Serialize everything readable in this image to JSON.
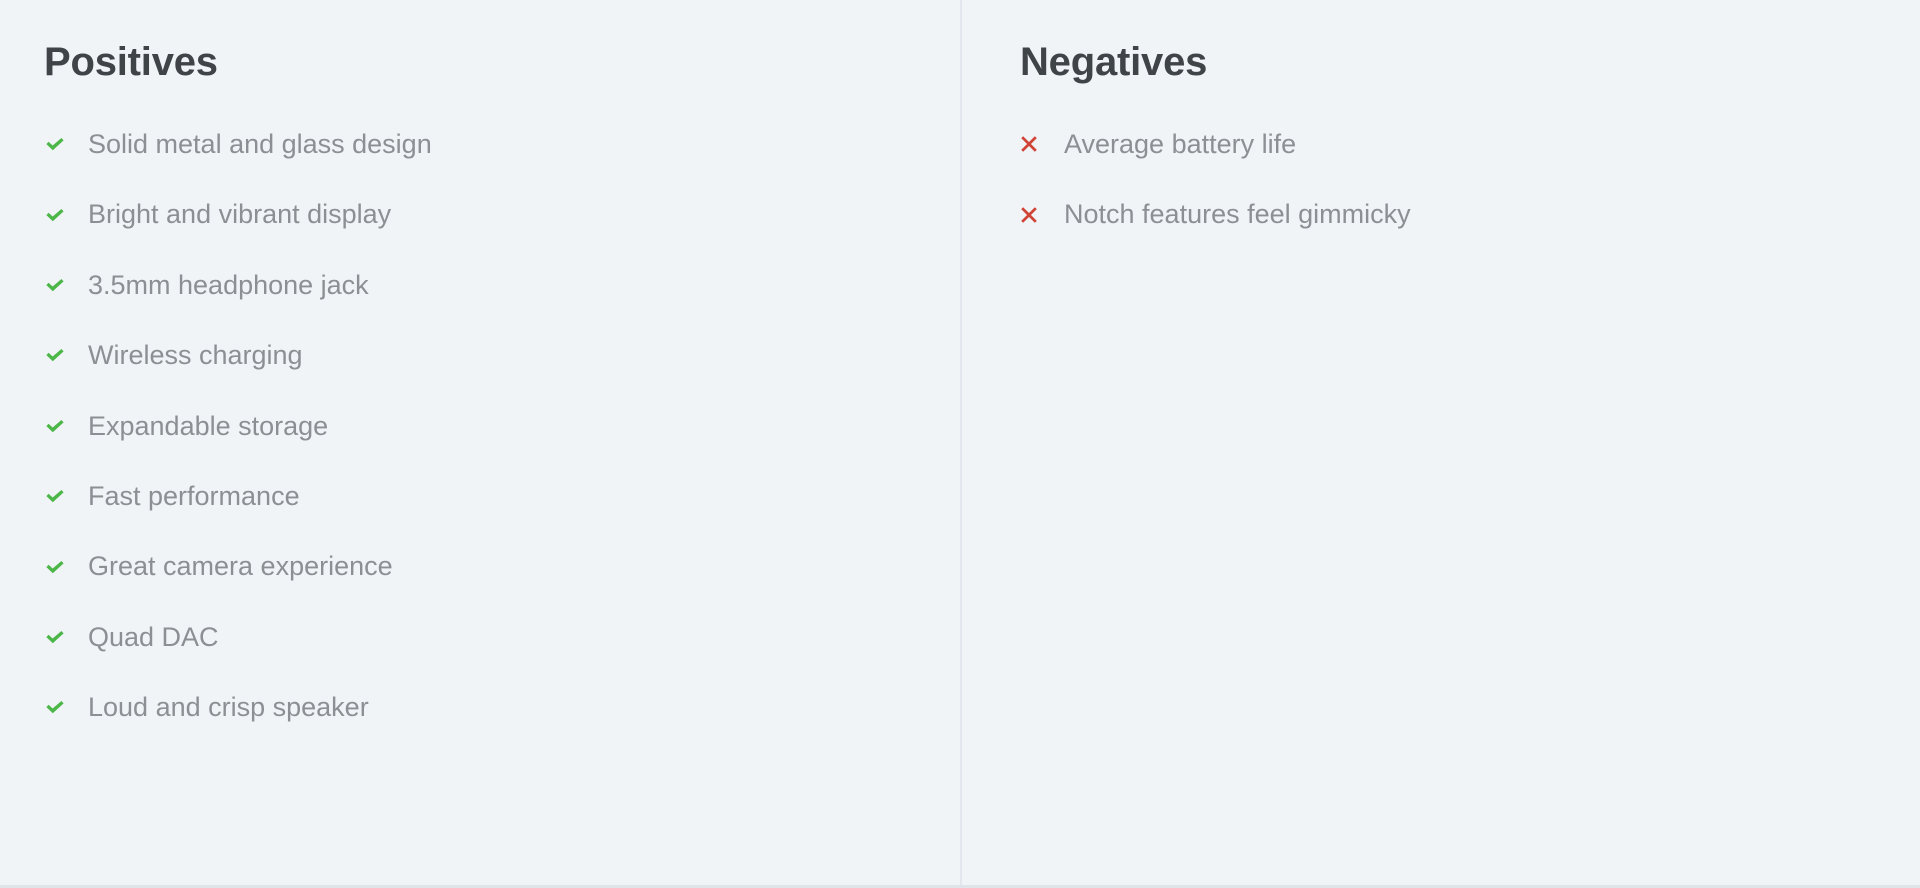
{
  "colors": {
    "background": "#f1f4f7",
    "divider": "#e3e7ed",
    "bottom_border": "#dfe4ea",
    "heading_text": "#3f4449",
    "item_text": "#8c8f93",
    "check_green": "#4cb748",
    "cross_red": "#cf4436"
  },
  "positives": {
    "heading": "Positives",
    "icon_name": "check-icon",
    "items": [
      {
        "label": "Solid metal and glass design"
      },
      {
        "label": "Bright and vibrant display"
      },
      {
        "label": "3.5mm headphone jack"
      },
      {
        "label": "Wireless charging"
      },
      {
        "label": "Expandable storage"
      },
      {
        "label": "Fast performance"
      },
      {
        "label": "Great camera experience"
      },
      {
        "label": "Quad DAC"
      },
      {
        "label": "Loud and crisp speaker"
      }
    ]
  },
  "negatives": {
    "heading": "Negatives",
    "icon_name": "times-icon",
    "items": [
      {
        "label": "Average battery life"
      },
      {
        "label": "Notch features feel gimmicky"
      }
    ]
  }
}
